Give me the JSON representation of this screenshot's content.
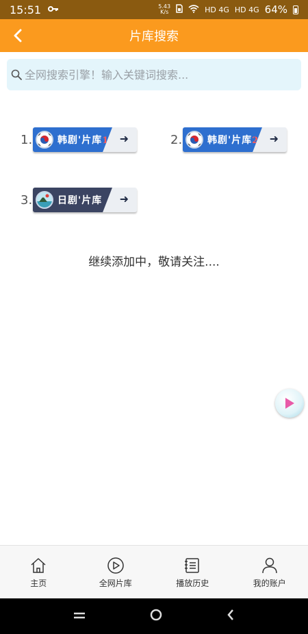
{
  "status_bar": {
    "time": "15:51",
    "net_speed_value": "5.43",
    "net_speed_unit": "K/s",
    "signal1_label": "HD",
    "signal1_type": "4G",
    "signal2_label": "HD",
    "signal2_type": "4G",
    "battery_percent": "64%"
  },
  "app_bar": {
    "title": "片库搜索",
    "back_icon": "chevron-left-icon"
  },
  "search": {
    "placeholder": "全网搜索引擎！输入关键词搜索...",
    "icon": "search-icon"
  },
  "libraries": [
    {
      "index": "1.",
      "label": "韩剧'片库",
      "badge": "1",
      "flag": "korea-flag-icon"
    },
    {
      "index": "2.",
      "label": "韩剧'片库",
      "badge": "2",
      "flag": "korea-flag-icon"
    },
    {
      "index": "3.",
      "label": "日剧'片库",
      "badge": "",
      "flag": "japan-scenery-icon"
    }
  ],
  "notice": "继续添加中，敬请关注....",
  "bottom_nav": [
    {
      "label": "主页",
      "icon": "home-icon"
    },
    {
      "label": "全网片库",
      "icon": "play-circle-icon"
    },
    {
      "label": "播放历史",
      "icon": "history-list-icon"
    },
    {
      "label": "我的账户",
      "icon": "user-icon"
    }
  ],
  "colors": {
    "app_bar": "#fb9a1e",
    "status_bar": "#8a5a10",
    "search_bg": "#e4f5fb",
    "lib_blue": "#2e6fcf",
    "lib_dark": "#3b4462"
  }
}
